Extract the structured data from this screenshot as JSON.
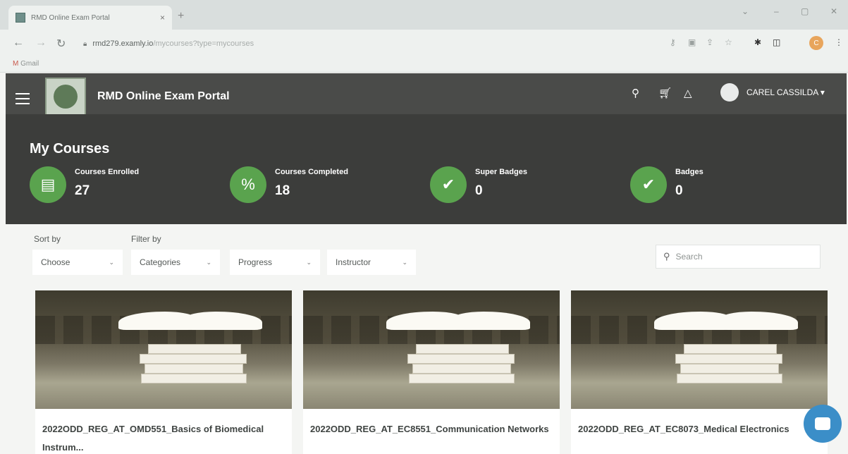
{
  "browser": {
    "tab_title": "RMD Online Exam Portal",
    "tab_close": "×",
    "new_tab": "+",
    "url_host": "rmd279.examly.io",
    "url_path": "/mycourses?type=mycourses",
    "bookmark": "Gmail",
    "profile_initial": "C"
  },
  "header": {
    "title": "RMD Online Exam Portal",
    "user": "CAREL CASSILDA ▾"
  },
  "stats": {
    "title": "My Courses",
    "items": [
      {
        "label": "Courses Enrolled",
        "value": "27",
        "icon": "book-icon"
      },
      {
        "label": "Courses Completed",
        "value": "18",
        "icon": "percent-icon"
      },
      {
        "label": "Super Badges",
        "value": "0",
        "icon": "badge-icon"
      },
      {
        "label": "Badges",
        "value": "0",
        "icon": "badge-icon"
      }
    ]
  },
  "filters": {
    "sort_label": "Sort by",
    "filter_label": "Filter by",
    "sort_value": "Choose",
    "categories": "Categories",
    "progress": "Progress",
    "instructor": "Instructor",
    "search_placeholder": "Search"
  },
  "courses": [
    {
      "title": "2022ODD_REG_AT_OMD551_Basics of Biomedical Instrum..."
    },
    {
      "title": "2022ODD_REG_AT_EC8551_Communication Networks"
    },
    {
      "title": "2022ODD_REG_AT_EC8073_Medical Electronics"
    }
  ],
  "colors": {
    "accent_green": "#5aa34e",
    "header_bg": "#4a4b49",
    "chat_blue": "#3b8ec8"
  }
}
